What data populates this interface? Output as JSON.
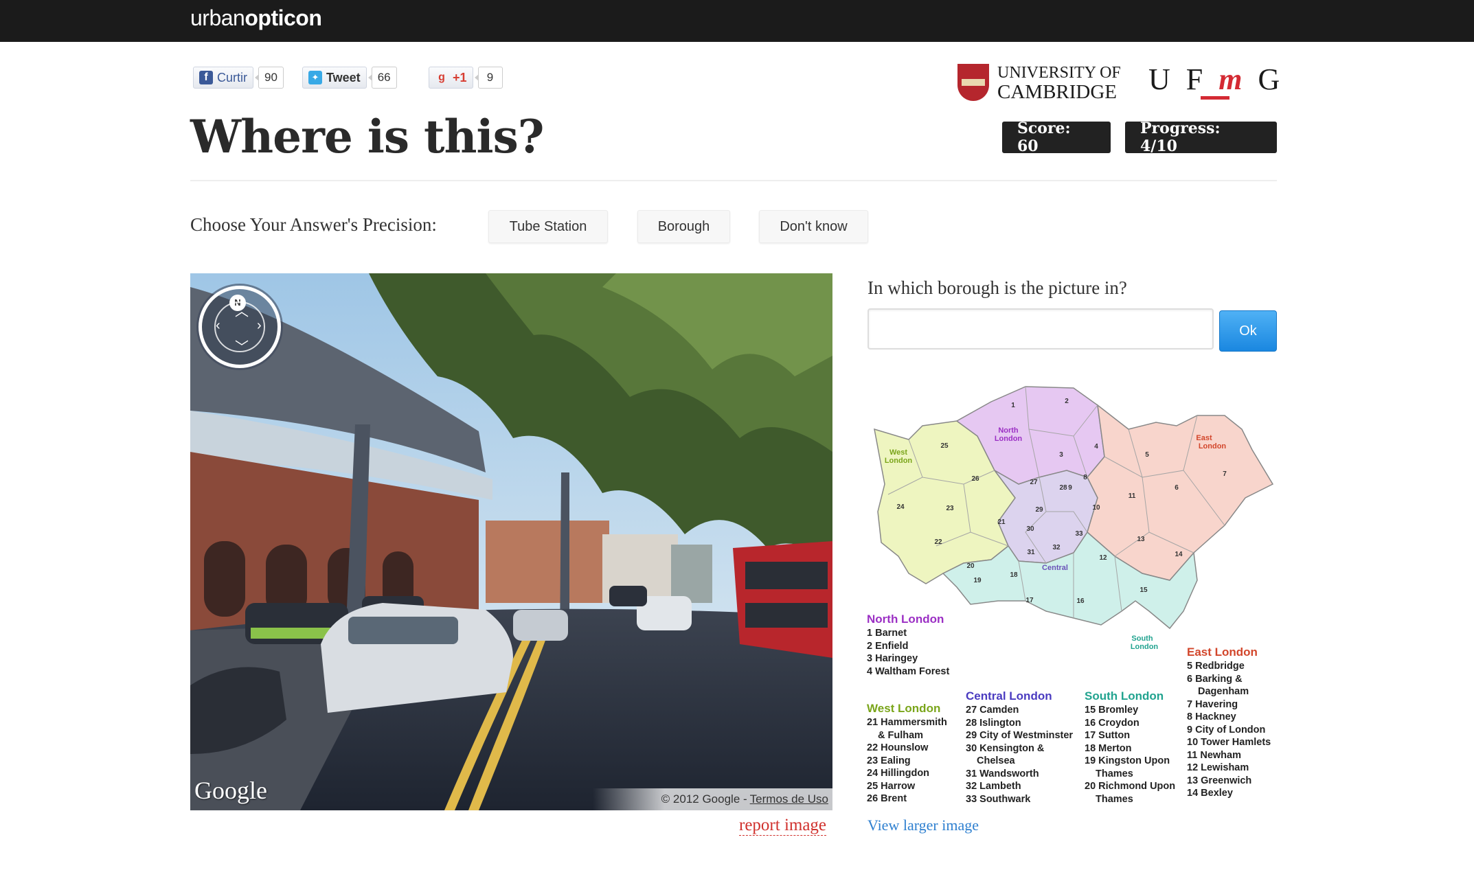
{
  "app": {
    "brand_regular": "urban",
    "brand_bold": "opticon"
  },
  "social": {
    "facebook": {
      "label": "Curtir",
      "count": "90"
    },
    "twitter": {
      "label": "Tweet",
      "count": "66"
    },
    "gplus": {
      "label": "+1",
      "count": "9"
    }
  },
  "logos": {
    "cambridge_line1": "UNIVERSITY OF",
    "cambridge_line2": "CAMBRIDGE",
    "ufmg_prefix": "U F",
    "ufmg_m": "m",
    "ufmg_suffix": "G"
  },
  "header": {
    "title": "Where is this?",
    "score": "Score: 60",
    "progress": "Progress: 4/10"
  },
  "precision": {
    "label": "Choose Your Answer's Precision:",
    "options": [
      "Tube Station",
      "Borough",
      "Don't know"
    ]
  },
  "streetview": {
    "compass_n": "N",
    "google_logo": "Google",
    "copyright": "© 2012 Google -",
    "terms": "Termos de Uso",
    "report": "report image"
  },
  "question": {
    "text": "In which borough is the picture in?",
    "input_value": "",
    "ok": "Ok"
  },
  "map": {
    "region_labels": {
      "north": [
        "North",
        "London"
      ],
      "west": [
        "West",
        "London"
      ],
      "east": [
        "East",
        "London"
      ],
      "south": [
        "South",
        "London"
      ],
      "central": "Central"
    },
    "numbers": [
      "1",
      "2",
      "3",
      "4",
      "5",
      "6",
      "7",
      "8",
      "9",
      "10",
      "11",
      "12",
      "13",
      "14",
      "15",
      "16",
      "17",
      "18",
      "19",
      "20",
      "21",
      "22",
      "23",
      "24",
      "25",
      "26",
      "27",
      "28",
      "29",
      "30",
      "31",
      "32",
      "33"
    ],
    "colors": {
      "north": "#e6c8f2",
      "west": "#eef5c0",
      "east": "#f8d5cc",
      "south": "#cff0ea",
      "central": "#dcd3ee"
    },
    "legend": {
      "north": {
        "title": "North London",
        "items": [
          "1 Barnet",
          "2 Enfield",
          "3 Haringey",
          "4 Waltham Forest"
        ]
      },
      "west": {
        "title": "West London",
        "items": [
          "21 Hammersmith",
          "& Fulham",
          "22 Hounslow",
          "23 Ealing",
          "24 Hillingdon",
          "25 Harrow",
          "26 Brent"
        ]
      },
      "central": {
        "title": "Central London",
        "items": [
          "27 Camden",
          "28 Islington",
          "29 City of Westminster",
          "30 Kensington &",
          "Chelsea",
          "31 Wandsworth",
          "32 Lambeth",
          "33 Southwark"
        ]
      },
      "south": {
        "title": "South London",
        "items": [
          "15 Bromley",
          "16 Croydon",
          "17 Sutton",
          "18 Merton",
          "19 Kingston Upon",
          "Thames",
          "20 Richmond Upon",
          "Thames"
        ]
      },
      "east": {
        "title": "East London",
        "items": [
          "5 Redbridge",
          "6 Barking &",
          "Dagenham",
          "7 Havering",
          "8 Hackney",
          "9 City of London",
          "10 Tower Hamlets",
          "11 Newham",
          "12 Lewisham",
          "13 Greenwich",
          "14 Bexley"
        ]
      }
    },
    "view_larger": "View larger image"
  }
}
